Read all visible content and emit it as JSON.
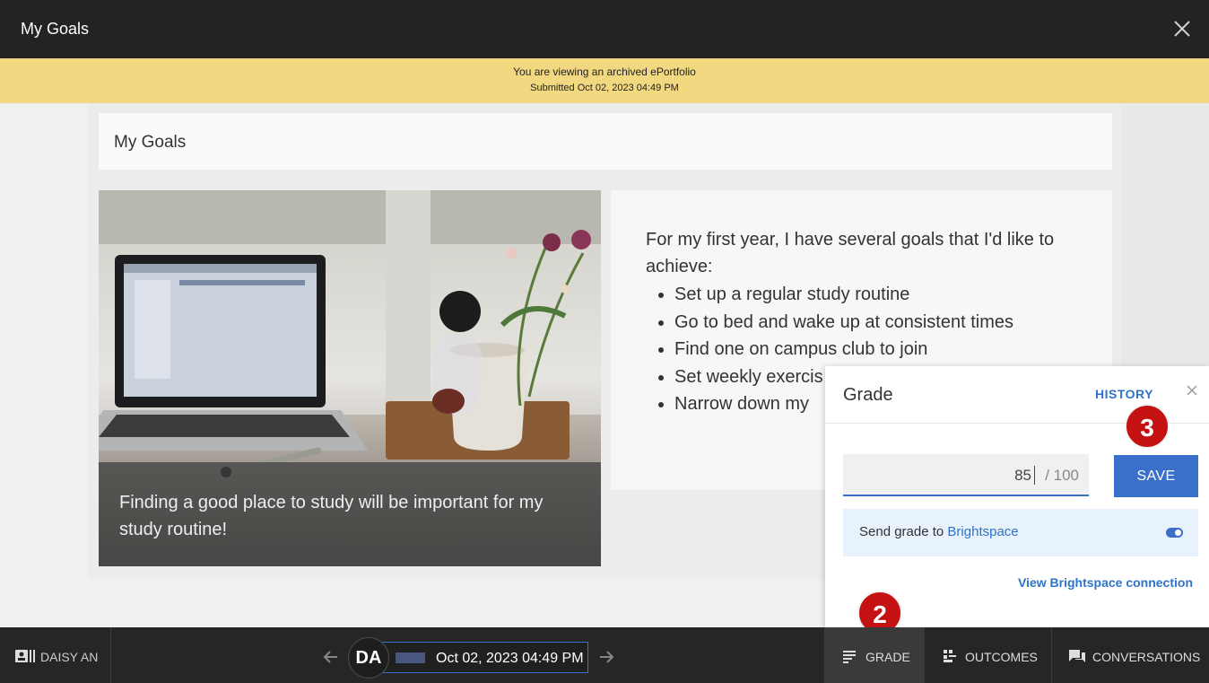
{
  "window": {
    "title": "My Goals"
  },
  "banner": {
    "line1": "You are viewing an archived ePortfolio",
    "line2": "Submitted Oct 02, 2023 04:49 PM"
  },
  "artifact": {
    "heading": "My Goals",
    "image_caption": "Finding a good place to study will be important for my study routine!",
    "intro": "For my first year, I have several goals that I'd like to achieve:",
    "goals": [
      "Set up a regular study routine",
      "Go to bed and wake up at consistent times",
      "Find one on campus club to join",
      "Set weekly exercis",
      "Narrow down my "
    ]
  },
  "grade_panel": {
    "title": "Grade",
    "history_label": "HISTORY",
    "score_value": "85",
    "score_max": "/ 100",
    "save_label": "SAVE",
    "send_text": "Send grade to ",
    "send_link": "Brightspace",
    "toggle_on": true,
    "view_connection_label": "View Brightspace connection"
  },
  "callouts": {
    "badge_2": "2",
    "badge_3": "3"
  },
  "bottom_bar": {
    "student_name": "DAISY AN",
    "avatar_initials": "DA",
    "submission_date": "Oct 02, 2023 04:49 PM",
    "tabs": [
      {
        "label": "GRADE",
        "icon": "grade-icon",
        "active": true
      },
      {
        "label": "OUTCOMES",
        "icon": "outcomes-icon",
        "active": false
      },
      {
        "label": "CONVERSATIONS",
        "icon": "conversations-icon",
        "active": false
      }
    ]
  },
  "colors": {
    "banner": "#f2d880",
    "accent": "#3a70c9",
    "badge": "#c41212",
    "topbar": "#232323"
  }
}
